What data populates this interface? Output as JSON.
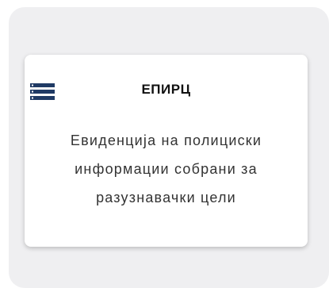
{
  "card": {
    "title": "ЕПИРЦ",
    "description": "Евиденција на полициски информации собрани за разузнавачки цели",
    "icon": "list-menu-icon",
    "icon_color": "#1f3a64"
  }
}
